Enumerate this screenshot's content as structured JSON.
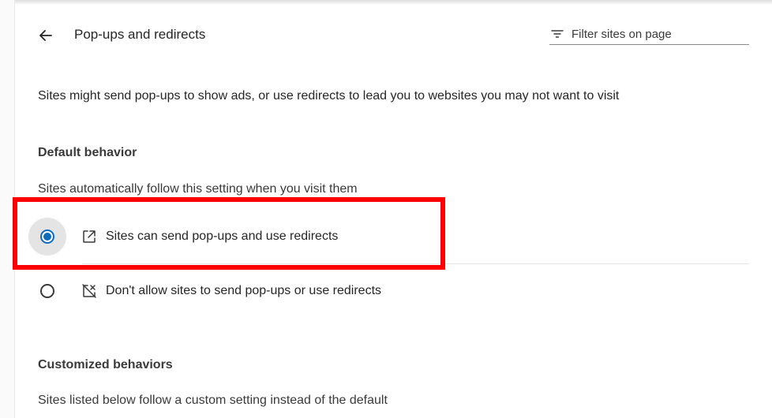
{
  "header": {
    "back_icon": "arrow-left-icon",
    "title": "Pop-ups and redirects",
    "filter": {
      "icon": "filter-icon",
      "placeholder": "Filter sites on page",
      "value": ""
    }
  },
  "description": "Sites might send pop-ups to show ads, or use redirects to lead you to websites you may not want to visit",
  "default_behavior": {
    "heading": "Default behavior",
    "subtext": "Sites automatically follow this setting when you visit them",
    "options": [
      {
        "label": "Sites can send pop-ups and use redirects",
        "icon": "open-in-new-window-icon",
        "selected": true
      },
      {
        "label": "Don't allow sites to send pop-ups or use redirects",
        "icon": "blocked-popup-icon",
        "selected": false
      }
    ]
  },
  "customized_behaviors": {
    "heading": "Customized behaviors",
    "subtext": "Sites listed below follow a custom setting instead of the default"
  },
  "colors": {
    "accent": "#0f6cbd",
    "highlight": "#ff0000",
    "text": "#262626"
  }
}
